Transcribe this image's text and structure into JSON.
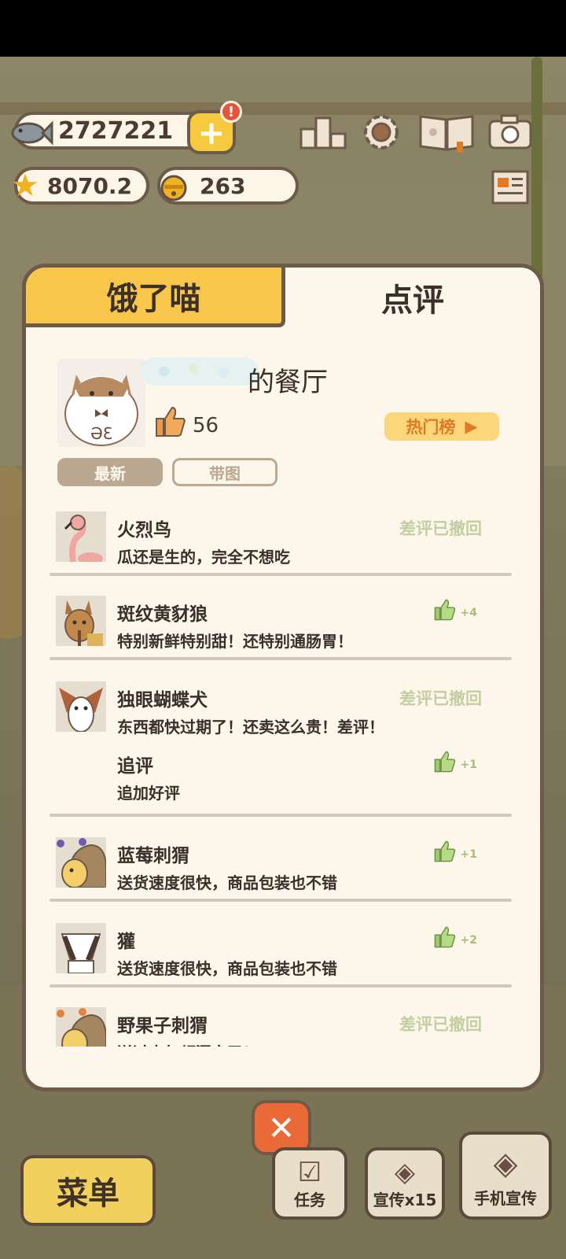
{
  "hud": {
    "fish_count": "2727221",
    "star_value": "8070.2",
    "bell_count": "263",
    "alert_mark": "!"
  },
  "tabs": {
    "left": "饿了喵",
    "right": "点评"
  },
  "restaurant": {
    "name_suffix": "的餐厅",
    "likes": "56",
    "hot_button": "热门榜"
  },
  "filters": {
    "newest": "最新",
    "with_photo": "带图"
  },
  "reviews": [
    {
      "reviewer": "火烈鸟",
      "text": "瓜还是生的，完全不想吃",
      "status": "差评已撤回",
      "avatar": "flamingo-avatar"
    },
    {
      "reviewer": "斑纹黄豺狼",
      "text": "特别新鲜特别甜！还特别通肠胃！",
      "likes": "+4",
      "avatar": "jackal-avatar"
    },
    {
      "reviewer": "独眼蝴蝶犬",
      "text": "东西都快过期了！还卖这么贵！差评！",
      "status": "差评已撤回",
      "followup_label": "追评",
      "followup_text": "追加好评",
      "followup_likes": "+1",
      "avatar": "papillon-avatar"
    },
    {
      "reviewer": "蓝莓刺猬",
      "text": "送货速度很快，商品包装也不错",
      "likes": "+1",
      "avatar": "hedgehog-avatar"
    },
    {
      "reviewer": "獾",
      "text": "送货速度很快，商品包装也不错",
      "likes": "+2",
      "avatar": "badger-avatar"
    },
    {
      "reviewer": "野果子刺猬",
      "text": "送过来气都漏完了！",
      "status": "差评已撤回",
      "avatar": "hedgehog2-avatar"
    }
  ],
  "bottom": {
    "menu": "菜单",
    "task": "任务",
    "promo": "宣传x15",
    "phone_promo": "手机宣传"
  },
  "colors": {
    "tab_active": "#f9c64c",
    "panel_bg": "#fdf6ea",
    "border": "#6e5a48",
    "close_button": "#e96a37",
    "retracted": "#c3cfa2"
  }
}
